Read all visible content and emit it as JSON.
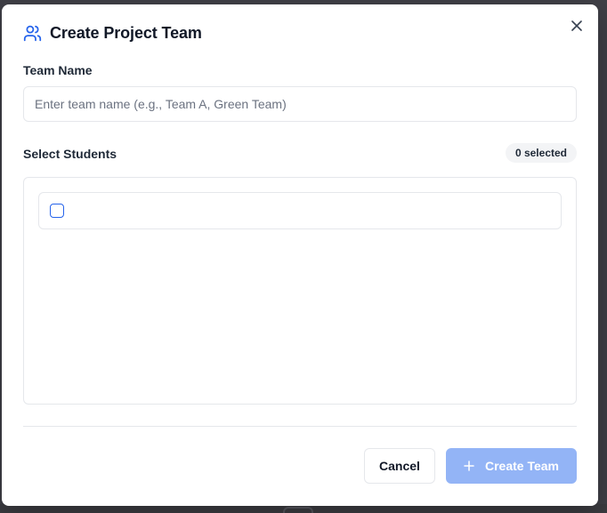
{
  "dialog": {
    "title": "Create Project Team",
    "icon": "users-icon",
    "close_icon": "close-icon"
  },
  "team_name": {
    "label": "Team Name",
    "value": "",
    "placeholder": "Enter team name (e.g., Team A, Green Team)"
  },
  "students": {
    "label": "Select Students",
    "selected_count_text": "0 selected",
    "rows": [
      {
        "checked": false,
        "name": ""
      }
    ]
  },
  "footer": {
    "cancel_label": "Cancel",
    "create_label": "Create Team",
    "create_icon": "plus-icon",
    "create_disabled": true
  },
  "colors": {
    "accent": "#2563eb",
    "primary_disabled": "#93b4f6",
    "border": "#e5e7eb",
    "backdrop": "#3f3f46"
  }
}
